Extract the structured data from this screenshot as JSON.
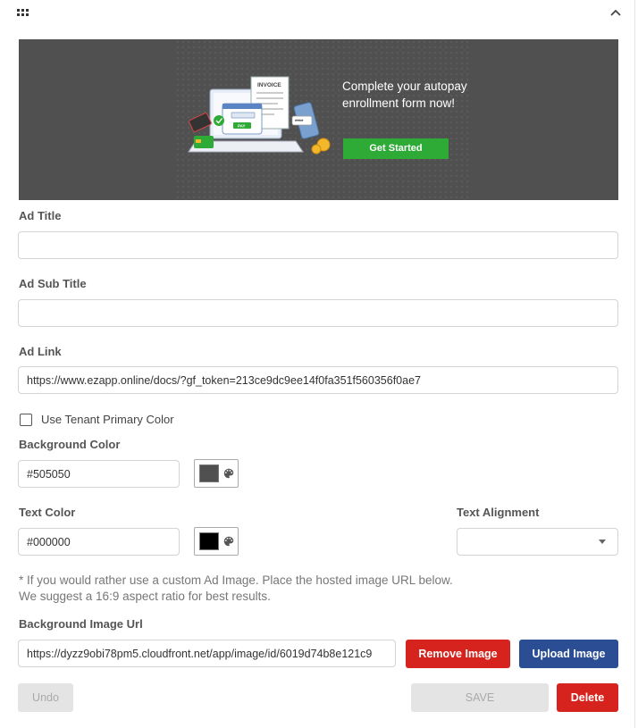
{
  "banner": {
    "text": "Complete your autopay enrollment form now!",
    "cta_label": "Get Started",
    "invoice_label": "INVOICE",
    "pay_label": "PAY",
    "stars_label": "****",
    "background_color": "#505050",
    "cta_color": "#2eab36"
  },
  "form": {
    "ad_title": {
      "label": "Ad Title",
      "value": ""
    },
    "ad_sub_title": {
      "label": "Ad Sub Title",
      "value": ""
    },
    "ad_link": {
      "label": "Ad Link",
      "value": "https://www.ezapp.online/docs/?gf_token=213ce9dc9ee14f0fa351f560356f0ae7"
    },
    "use_tenant_color": {
      "label": "Use Tenant Primary Color",
      "checked": false
    },
    "background_color": {
      "label": "Background Color",
      "value": "#505050",
      "swatch": "#505050"
    },
    "text_color": {
      "label": "Text Color",
      "value": "#000000",
      "swatch": "#000000"
    },
    "text_alignment": {
      "label": "Text Alignment",
      "value": ""
    },
    "note_line1": "* If you would rather use a custom Ad Image. Place the hosted image URL below.",
    "note_line2": "We suggest a 16:9 aspect ratio for best results.",
    "background_image_url": {
      "label": "Background Image Url",
      "value": "https://dyzz9obi78pm5.cloudfront.net/app/image/id/6019d74b8e121c9"
    }
  },
  "actions": {
    "remove_image": "Remove Image",
    "upload_image": "Upload Image",
    "undo": "Undo",
    "save": "SAVE",
    "delete": "Delete"
  },
  "icons": {
    "drag": "drag-handle-icon",
    "collapse": "chevron-up-icon",
    "palette": "palette-icon",
    "dropdown": "chevron-down-icon"
  }
}
